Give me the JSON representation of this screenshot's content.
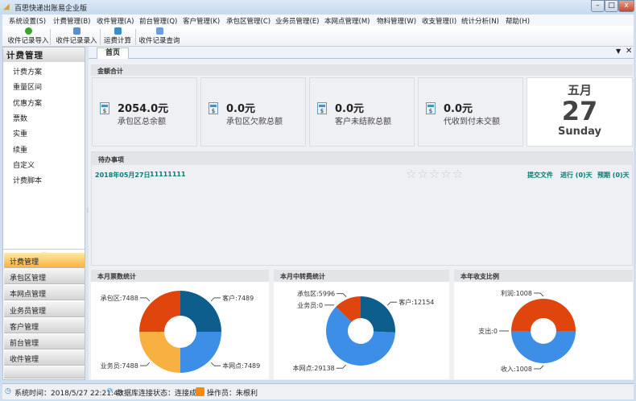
{
  "window": {
    "title": "百思快递出账易企业版",
    "min": "–",
    "max": "□",
    "close": "x"
  },
  "menu": [
    "系统设置(S)",
    "计费管理(B)",
    "收件管理(A)",
    "前台管理(Q)",
    "客户管理(K)",
    "承包区管理(C)",
    "业务员管理(E)",
    "本网点管理(M)",
    "物料管理(W)",
    "收支管理(I)",
    "统计分析(N)",
    "帮助(H)"
  ],
  "toolbar": [
    {
      "label": "收件记录导入",
      "color": "#3aa52b"
    },
    {
      "label": "收件记录录入",
      "color": "#5a8fd0"
    },
    {
      "label": "运费计算",
      "color": "#3b8fbf"
    },
    {
      "label": "收件记录查询",
      "color": "#6aa0d8"
    }
  ],
  "left": {
    "title": "计费管理",
    "tree": [
      "计费方案",
      "重量区间",
      "优惠方案",
      "票数",
      "实重",
      "续重",
      "自定义",
      "计费脚本"
    ],
    "accordion": [
      "计费管理",
      "承包区管理",
      "本网点管理",
      "业务员管理",
      "客户管理",
      "前台管理",
      "收件管理"
    ],
    "active": 0
  },
  "tabs": {
    "home": "首页",
    "menu_icon": "▼",
    "close_icon": "✕"
  },
  "amounts": {
    "header": "金额合计",
    "cards": [
      {
        "value": "2054.0元",
        "label": "承包区总余额"
      },
      {
        "value": "0.0元",
        "label": "承包区欠款总额"
      },
      {
        "value": "0.0元",
        "label": "客户未结款总额"
      },
      {
        "value": "0.0元",
        "label": "代收到付未交额"
      }
    ],
    "icon": "$"
  },
  "calendar": {
    "month": "五月",
    "day": "27",
    "weekday": "Sunday"
  },
  "todo": {
    "header": "待办事项",
    "date": "2018年05月27日",
    "text": "11111111",
    "stars": "☆☆☆☆☆",
    "submit": "提交文件",
    "progress": "进行 (0)天",
    "overdue": "预期 (0)天"
  },
  "chart_data": [
    {
      "type": "pie",
      "title": "本月票数统计",
      "labels": [
        "客户",
        "本网点",
        "业务员",
        "承包区"
      ],
      "values": [
        7489,
        7489,
        7488,
        7488
      ],
      "colors": [
        "#0d5e8c",
        "#3d8ee6",
        "#f8b040",
        "#e0450e"
      ]
    },
    {
      "type": "pie",
      "title": "本月中转费统计",
      "labels": [
        "客户",
        "本网点",
        "业务员",
        "承包区"
      ],
      "values": [
        12154,
        29138,
        0,
        5996
      ],
      "colors": [
        "#0d5e8c",
        "#3d8ee6",
        "#f8b040",
        "#e0450e"
      ]
    },
    {
      "type": "pie",
      "title": "本年收支比例",
      "labels": [
        "收入",
        "支出",
        "利润"
      ],
      "values": [
        1008,
        0,
        1008
      ],
      "colors": [
        "#3d8ee6",
        "#f8b040",
        "#e0450e"
      ]
    }
  ],
  "status": {
    "time": "系统时间：2018/5/27 22:21:43",
    "db": "数据库连接状态：连接成功",
    "operator": "操作员：朱根利"
  }
}
